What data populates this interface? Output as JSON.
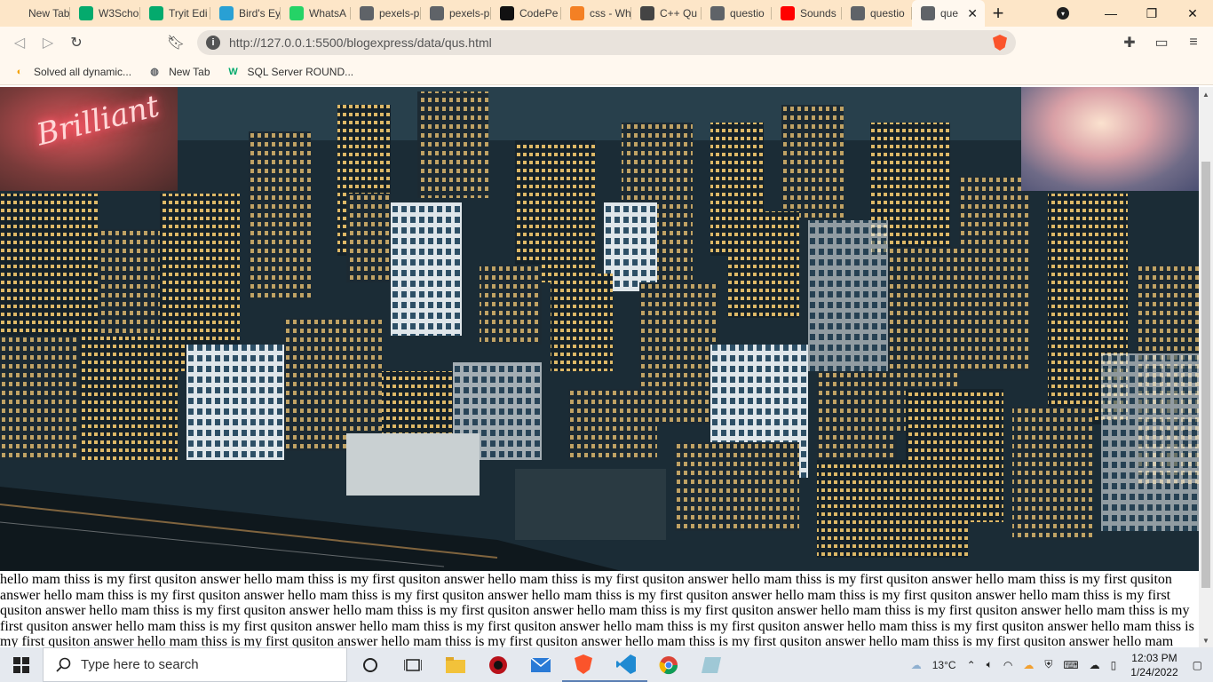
{
  "browser": {
    "tabs": [
      {
        "label": "New Tab",
        "icon": "new-tab-icon",
        "color": "#fde6c8"
      },
      {
        "label": "W3Scho",
        "icon": "w3schools-icon",
        "color": "#04aa6d"
      },
      {
        "label": "Tryit Edi",
        "icon": "w3schools-icon",
        "color": "#04aa6d"
      },
      {
        "label": "Bird's Ey",
        "icon": "d-icon",
        "color": "#29a0d4"
      },
      {
        "label": "WhatsA",
        "icon": "whatsapp-icon",
        "color": "#25d366"
      },
      {
        "label": "pexels-p",
        "icon": "globe-icon",
        "color": "#5f6368"
      },
      {
        "label": "pexels-p",
        "icon": "globe-icon",
        "color": "#5f6368"
      },
      {
        "label": "CodePe",
        "icon": "codepen-icon",
        "color": "#111111"
      },
      {
        "label": "css - Wh",
        "icon": "stackoverflow-icon",
        "color": "#f48024"
      },
      {
        "label": "C++ Qu",
        "icon": "diamond-icon",
        "color": "#444444"
      },
      {
        "label": "questio",
        "icon": "globe-icon",
        "color": "#5f6368"
      },
      {
        "label": "Sounds",
        "icon": "youtube-icon",
        "color": "#ff0000"
      },
      {
        "label": "questio",
        "icon": "globe-icon",
        "color": "#5f6368"
      },
      {
        "label": "que",
        "icon": "globe-icon",
        "color": "#5f6368",
        "active": true
      }
    ],
    "url": "http://127.0.0.1:5500/blogexpress/data/qus.html",
    "bookmarks": [
      {
        "label": "Solved all dynamic...",
        "icon": "bookmark-logo-icon"
      },
      {
        "label": "New Tab",
        "icon": "globe-icon"
      },
      {
        "label": "SQL Server ROUND...",
        "icon": "w3schools-icon"
      }
    ]
  },
  "page": {
    "neon_sign_text": "Brilliant",
    "body_text": "hello mam thiss is my first qusiton answer hello mam thiss is my first qusiton answer hello mam thiss is my first qusiton answer hello mam thiss is my first qusiton answer hello mam thiss is my first qusiton answer hello mam thiss is my first qusiton answer hello mam thiss is my first qusiton answer hello mam thiss is my first qusiton answer hello mam thiss is my first qusiton answer hello mam thiss is my first qusiton answer hello mam thiss is my first qusiton answer hello mam thiss is my first qusiton answer hello mam thiss is my first qusiton answer hello mam thiss is my first qusiton answer hello mam thiss is my first qusiton answer hello mam thiss is my first qusiton answer hello mam thiss is my first qusiton answer hello mam thiss is my first qusiton answer hello mam thiss is my first qusiton answer hello mam thiss is my first qusiton answer hello mam thiss is my first qusiton answer hello mam thiss is my first qusiton answer hello mam thiss is my first qusiton answer hello mam thiss is my first qusiton answer hello mam thiss is my first qusiton answer hello mam thiss is my first qusiton answer hello mam thiss is my first qusiton answer hello mam"
  },
  "taskbar": {
    "search_placeholder": "Type here to search",
    "weather": "13°C",
    "time": "12:03 PM",
    "date": "1/24/2022"
  }
}
